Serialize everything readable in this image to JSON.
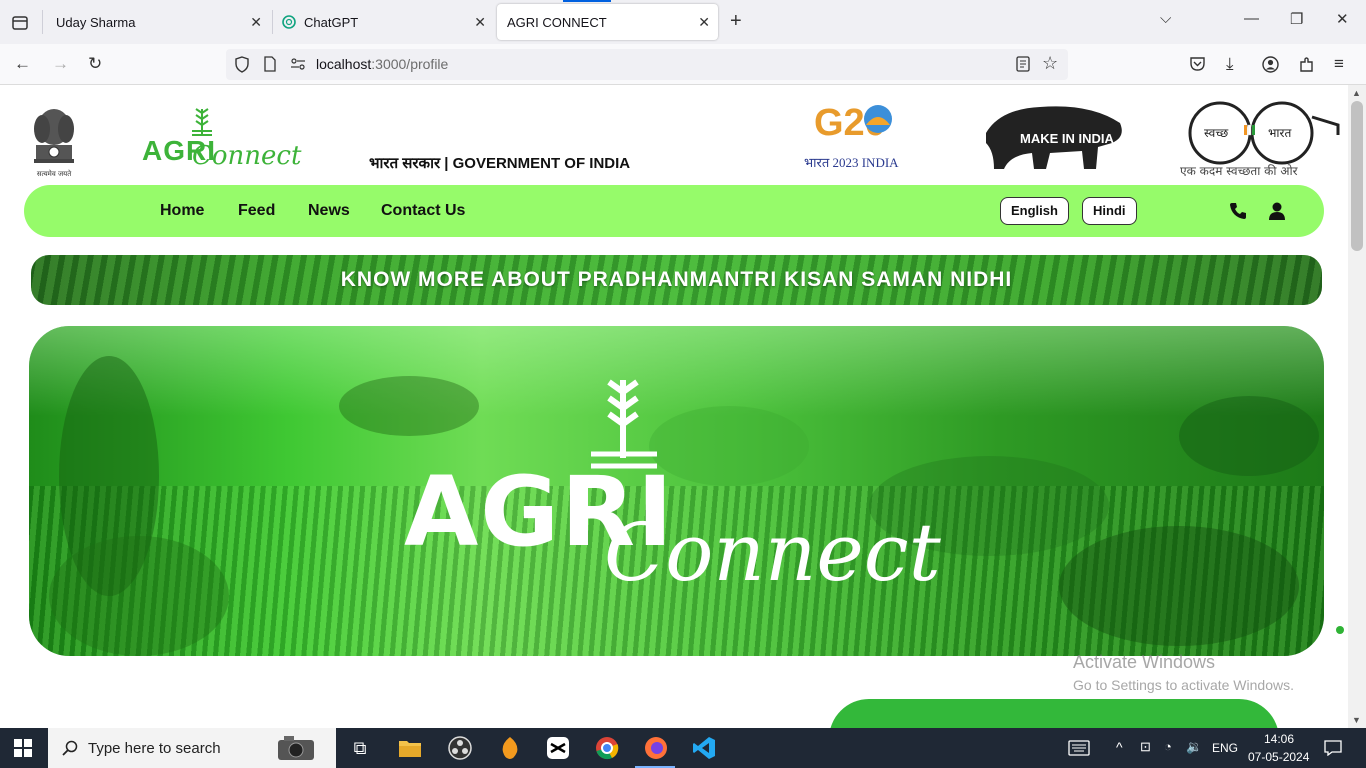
{
  "browser": {
    "tabs": [
      {
        "title": "Uday Sharma"
      },
      {
        "title": "ChatGPT"
      },
      {
        "title": "AGRI CONNECT"
      }
    ],
    "url_host": "localhost",
    "url_path": ":3000/profile"
  },
  "header": {
    "emblem_caption": "सत्यमेव जयते",
    "brand_agri": "AGRI",
    "brand_connect": "Connect",
    "gov_text": "भारत सरकार | GOVERNMENT OF INDIA",
    "g20_top": "G20",
    "g20_bottom": "भारत 2023 INDIA",
    "make_in_india": "MAKE IN INDIA",
    "swachh_left": "स्वच्छ",
    "swachh_right": "भारत",
    "swachh_tagline": "एक कदम स्वच्छता की ओर"
  },
  "nav": {
    "links": [
      "Home",
      "Feed",
      "News",
      "Contact Us"
    ],
    "lang_english": "English",
    "lang_hindi": "Hindi"
  },
  "banner": {
    "text": "KNOW MORE ABOUT PRADHANMANTRI KISAN SAMAN NIDHI"
  },
  "hero": {
    "logo_agri": "AGRI",
    "logo_connect": "Connect"
  },
  "watermark": {
    "title": "Activate Windows",
    "subtitle": "Go to Settings to activate Windows."
  },
  "taskbar": {
    "search_placeholder": "Type here to search",
    "language": "ENG",
    "time": "14:06",
    "date": "07-05-2024"
  },
  "colors": {
    "nav_green": "#96fb6a",
    "brand_green": "#3db339"
  }
}
